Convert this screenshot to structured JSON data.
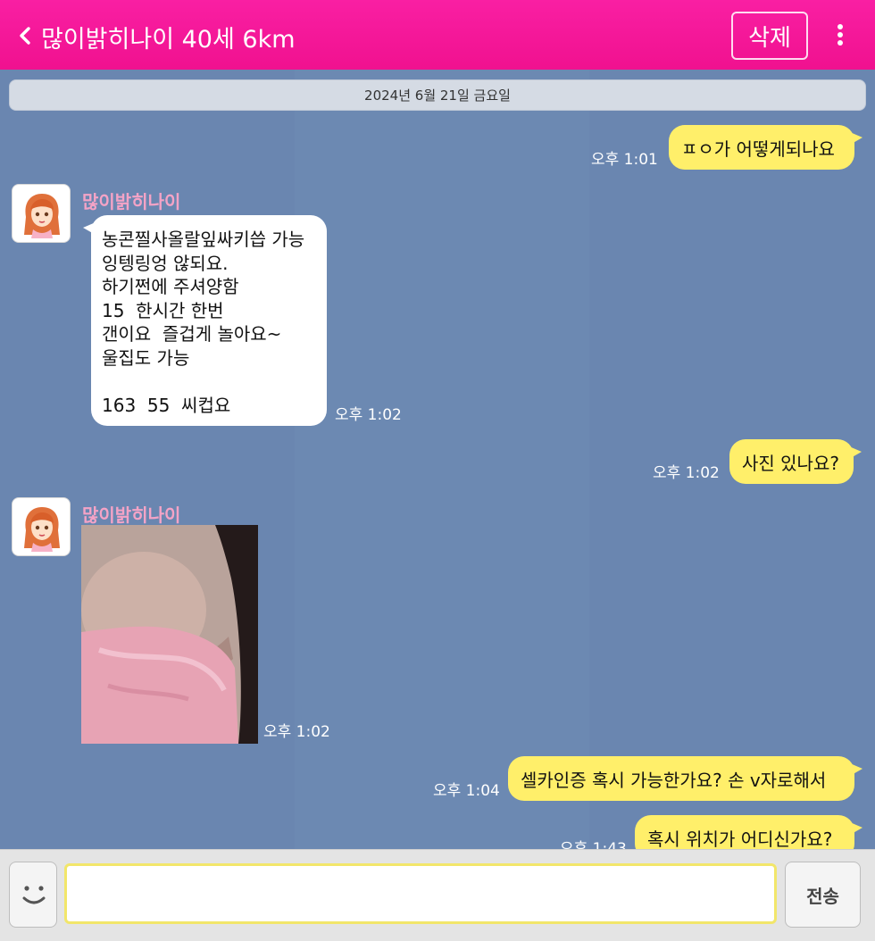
{
  "header": {
    "title": "많이밝히나이 40세 6km",
    "delete_label": "삭제",
    "back_icon": "chevron-left-icon",
    "more_icon": "more-vertical-icon"
  },
  "date_divider": "2024년 6월 21일 금요일",
  "contact": {
    "name": "많이밝히나이",
    "avatar": "female-avatar-icon"
  },
  "messages": [
    {
      "dir": "out",
      "text": "ㅍㅇ가 어떻게되나요",
      "time": "오후 1:01"
    },
    {
      "dir": "in",
      "lines": [
        "농콘찔사올랄잎싸키씁 가능",
        "잉텡링엉 않되요.",
        "하기쩐에 주셔양함",
        "15  한시간 한번",
        "갠이요  즐겁게 놀아요~",
        "울집도 가능",
        "",
        "163  55  씨컵요"
      ],
      "time": "오후 1:02"
    },
    {
      "dir": "out",
      "text": "사진 있나요?",
      "time": "오후 1:02"
    },
    {
      "dir": "in",
      "type": "photo",
      "time": "오후 1:02"
    },
    {
      "dir": "out",
      "text": "셀카인증 혹시 가능한가요? 손 v자로해서",
      "time": "오후 1:04"
    },
    {
      "dir": "out",
      "text": "혹시 위치가 어디신가요?",
      "time": "오후 1:43"
    }
  ],
  "input": {
    "placeholder": "",
    "send_label": "전송",
    "emoji_icon": "smiley-icon"
  },
  "colors": {
    "header": "#f0118f",
    "chat_background": "#6a86b0",
    "outgoing_bubble": "#ffef6a",
    "incoming_bubble": "#ffffff",
    "sender_name": "#f4a3c6"
  }
}
